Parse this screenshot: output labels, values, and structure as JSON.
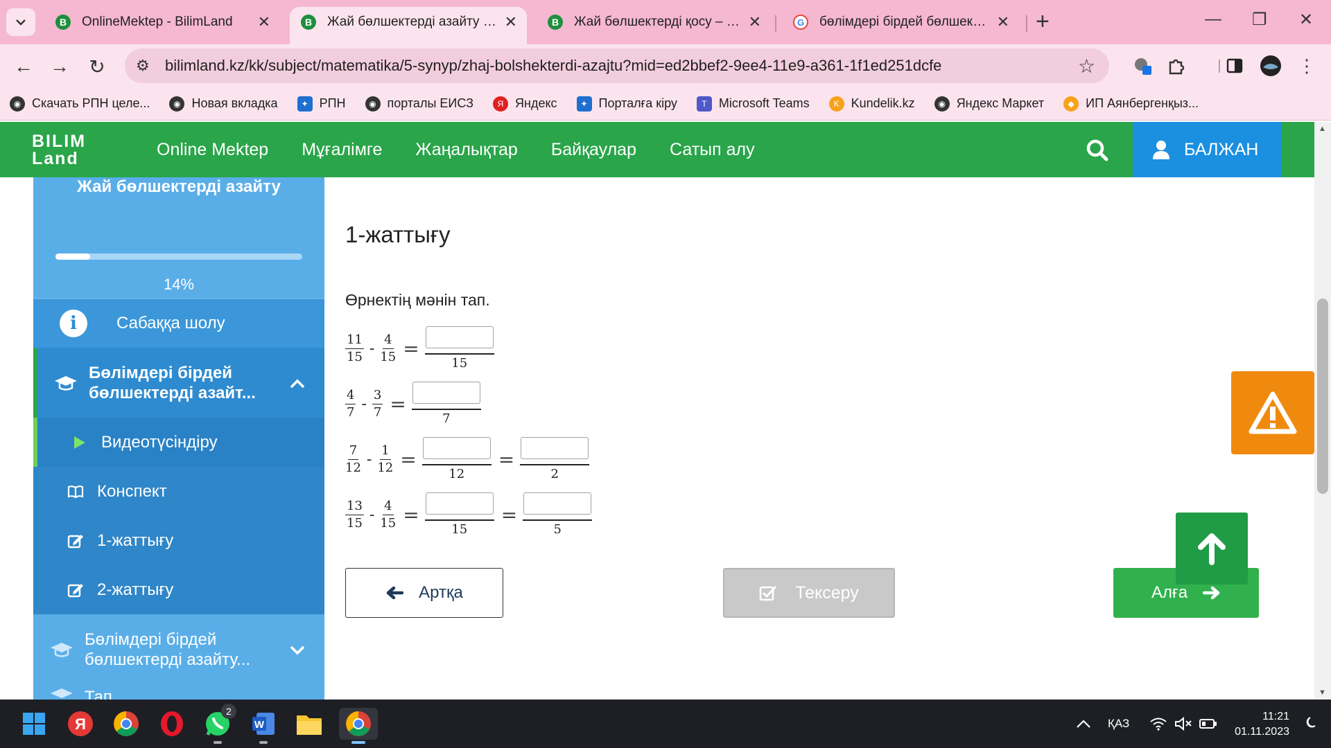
{
  "browser": {
    "tabs": [
      {
        "title": "OnlineMektep - BilimLand",
        "active": false,
        "favicon": "bilimland-icon"
      },
      {
        "title": "Жай бөлшектерді азайту – Ма",
        "active": true,
        "favicon": "bilimland-icon"
      },
      {
        "title": "Жай бөлшектерді қосу – Мате",
        "active": false,
        "favicon": "bilimland-icon"
      },
      {
        "title": "бөлімдері бірдей бөлшектерд",
        "active": false,
        "favicon": "google-icon"
      }
    ],
    "url": "bilimland.kz/kk/subject/matematika/5-synyp/zhaj-bolshekterdi-azajtu?mid=ed2bbef2-9ee4-11e9-a361-1f1ed251dcfe",
    "bookmarks": [
      "Скачать РПН целе...",
      "Новая вкладка",
      "РПН",
      "порталы ЕИСЗ",
      "Яндекс",
      "Порталға кіру",
      "Microsoft Teams",
      "Kundelik.kz",
      "Яндекс Маркет",
      "ИП Аянбергенқыз..."
    ]
  },
  "site": {
    "logo_line1": "BILIM",
    "logo_line2": "Land",
    "nav": [
      "Online Mektep",
      "Мұғалімге",
      "Жаңалықтар",
      "Байқаулар",
      "Сатып алу"
    ],
    "user_name": "БАЛЖАН",
    "brand_color": "#2aa54a"
  },
  "sidebar": {
    "title": "Жай бөлшектерді азайту",
    "progress_percent": 14,
    "progress_label": "14%",
    "overview": "Сабаққа шолу",
    "module1": "Бөлімдері бірдей бөлшектерді азайт...",
    "items": [
      "Видеотүсіндіру",
      "Конспект",
      "1-жаттығу",
      "2-жаттығу"
    ],
    "module2": "Бөлімдері бірдей бөлшектерді азайту...",
    "module3": "Тап..."
  },
  "exercise": {
    "title": "1-жаттығу",
    "prompt": "Өрнектің мәнін тап.",
    "equations": [
      {
        "a": [
          "11",
          "15"
        ],
        "op": "-",
        "b": [
          "4",
          "15"
        ],
        "answers": [
          "15"
        ]
      },
      {
        "a": [
          "4",
          "7"
        ],
        "op": "-",
        "b": [
          "3",
          "7"
        ],
        "answers": [
          "7"
        ]
      },
      {
        "a": [
          "7",
          "12"
        ],
        "op": "-",
        "b": [
          "1",
          "12"
        ],
        "answers": [
          "12",
          "2"
        ]
      },
      {
        "a": [
          "13",
          "15"
        ],
        "op": "-",
        "b": [
          "4",
          "15"
        ],
        "answers": [
          "15",
          "5"
        ]
      }
    ],
    "back_label": "Артқа",
    "check_label": "Тексеру",
    "next_label": "Алға"
  },
  "taskbar": {
    "language": "ҚАЗ",
    "time": "11:21",
    "date": "01.11.2023",
    "whatsapp_badge": "2"
  }
}
